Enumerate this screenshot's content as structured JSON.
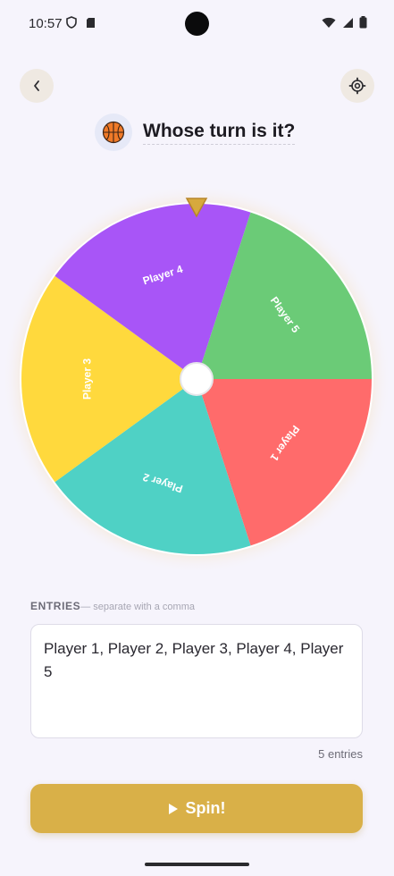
{
  "status": {
    "time": "10:57"
  },
  "header": {
    "title": "Whose turn is it?",
    "icon": "basketball-icon"
  },
  "wheel": {
    "pointer_color": "#d7a93d",
    "segments": [
      {
        "label": "Player 1",
        "color": "#ff6b6b"
      },
      {
        "label": "Player 2",
        "color": "#4fd1c5"
      },
      {
        "label": "Player 3",
        "color": "#ffd93d"
      },
      {
        "label": "Player 4",
        "color": "#a855f7"
      },
      {
        "label": "Player 5",
        "color": "#6bcb77"
      }
    ]
  },
  "entries": {
    "label": "ENTRIES",
    "hint": "— separate with a comma",
    "value": "Player 1, Player 2, Player 3, Player 4, Player 5",
    "count_text": "5 entries"
  },
  "spin": {
    "label": "Spin!",
    "icon": "play-icon",
    "color": "#d9b048"
  }
}
